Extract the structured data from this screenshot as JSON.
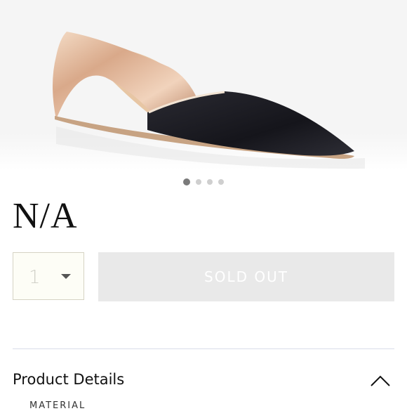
{
  "product": {
    "image_alt": "d'Orsay pointed flat shoe",
    "title": "N/A"
  },
  "carousel": {
    "count": 4,
    "active_index": 0
  },
  "purchase": {
    "quantity": "1",
    "sold_out_label": "SOLD OUT"
  },
  "details": {
    "header": "Product Details",
    "first_section": "MATERIAL"
  },
  "colors": {
    "sold_out_bg": "#e9e9e9",
    "qty_bg": "#fdfdf6"
  }
}
